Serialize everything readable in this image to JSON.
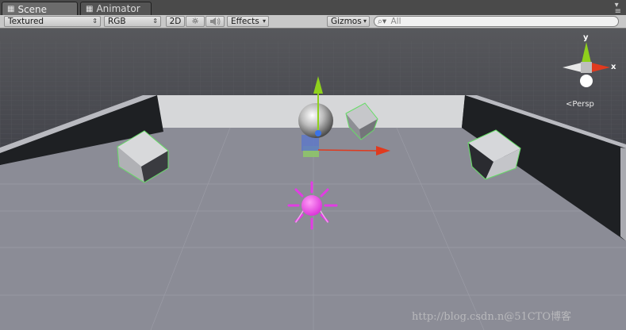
{
  "tabs": [
    {
      "label": "Scene",
      "icon": "scene-icon",
      "active": true
    },
    {
      "label": "Animator",
      "icon": "animator-icon",
      "active": false
    }
  ],
  "toolbar": {
    "draw_mode": "Textured",
    "channel": "RGB",
    "mode_2d": "2D",
    "lighting_icon": "sun-icon",
    "audio_icon": "speaker-icon",
    "effects": "Effects",
    "gizmos": "Gizmos",
    "search_placeholder": "All"
  },
  "viewport": {
    "orientation_gizmo": {
      "axis_y": "y",
      "axis_x": "x",
      "projection": "Persp"
    },
    "watermark": "http://blog.csdn.n@51CTO博客"
  },
  "colors": {
    "sky": "#4d4e52",
    "floor": "#8b8c96",
    "back_wall": "#d6d7d9",
    "side_wall": "#1e2023",
    "x_axis": "#e03a1e",
    "y_axis": "#8fd11c",
    "light_icon": "#e23ce3",
    "selection_outline": "#66dd66"
  }
}
